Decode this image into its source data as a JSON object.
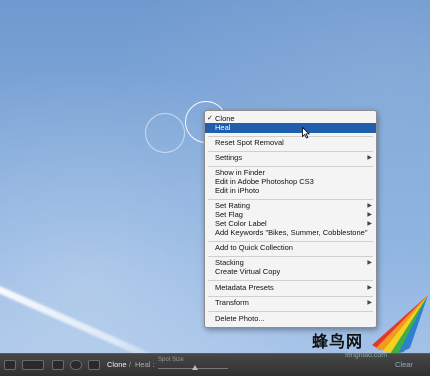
{
  "context_menu": {
    "items": [
      {
        "label": "Clone",
        "checked": true
      },
      {
        "label": "Heal",
        "selected": true
      },
      {
        "label": "Reset Spot Removal"
      },
      {
        "label": "Settings",
        "submenu": true
      },
      {
        "label": "Show in Finder"
      },
      {
        "label": "Edit in Adobe Photoshop CS3"
      },
      {
        "label": "Edit in iPhoto"
      },
      {
        "label": "Set Rating",
        "submenu": true
      },
      {
        "label": "Set Flag",
        "submenu": true
      },
      {
        "label": "Set Color Label",
        "submenu": true
      },
      {
        "label": "Add Keywords \"Bikes, Summer, Cobblestone\""
      },
      {
        "label": "Add to Quick Collection"
      },
      {
        "label": "Stacking",
        "submenu": true
      },
      {
        "label": "Create Virtual Copy"
      },
      {
        "label": "Metadata Presets",
        "submenu": true
      },
      {
        "label": "Transform",
        "submenu": true
      },
      {
        "label": "Delete Photo..."
      }
    ],
    "check_mark": "✓",
    "submenu_arrow": "▶"
  },
  "toolbar": {
    "mode_clone": "Clone",
    "mode_separator": "/",
    "mode_heal": "Heal :",
    "spot_size_label": "Spot Size",
    "clear_label": "Clear"
  },
  "watermark": {
    "text": "蜂鸟网",
    "url": "fengniao.com"
  },
  "icons": {
    "grid_view": "grid-view-icon",
    "compare_view": "compare-view-icon",
    "loupe_view": "loupe-view-icon",
    "spot_tool": "spot-tool-icon",
    "cursor": "arrow-cursor-icon"
  },
  "colors": {
    "menu_highlight": "#1f5fae",
    "sky": "#7fa7d8",
    "toolbar": "#3a3a3a"
  }
}
